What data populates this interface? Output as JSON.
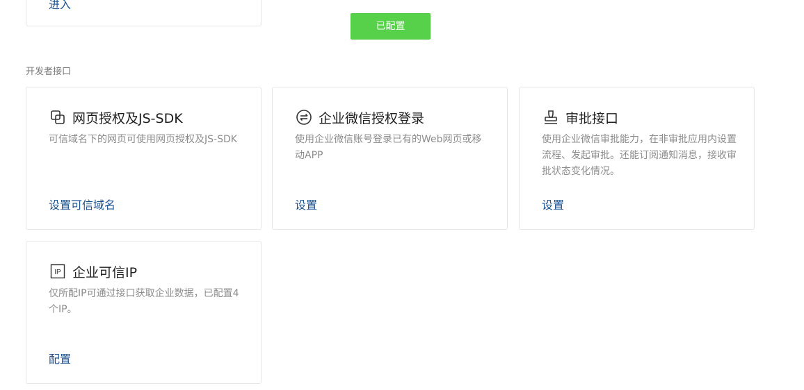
{
  "top_card": {
    "link_label": "进入"
  },
  "configured_button": "已配置",
  "section": {
    "title": "开发者接口"
  },
  "cards": [
    {
      "icon": "web-auth-icon",
      "title": "网页授权及JS-SDK",
      "description": "可信域名下的网页可使用网页授权及JS-SDK",
      "action": "设置可信域名"
    },
    {
      "icon": "wecom-login-icon",
      "title": "企业微信授权登录",
      "description": "使用企业微信账号登录已有的Web网页或移动APP",
      "action": "设置"
    },
    {
      "icon": "stamp-icon",
      "title": "审批接口",
      "description": "使用企业微信审批能力，在非审批应用内设置流程、发起审批。还能订阅通知消息，接收审批状态变化情况。",
      "action": "设置"
    },
    {
      "icon": "ip-icon",
      "title": "企业可信IP",
      "description": "仅所配IP可通过接口获取企业数据，已配置4个IP。",
      "action": "配置"
    }
  ],
  "colors": {
    "accent_green": "#57d14a",
    "link_blue": "#1a5290",
    "border": "#e4e6e9"
  }
}
